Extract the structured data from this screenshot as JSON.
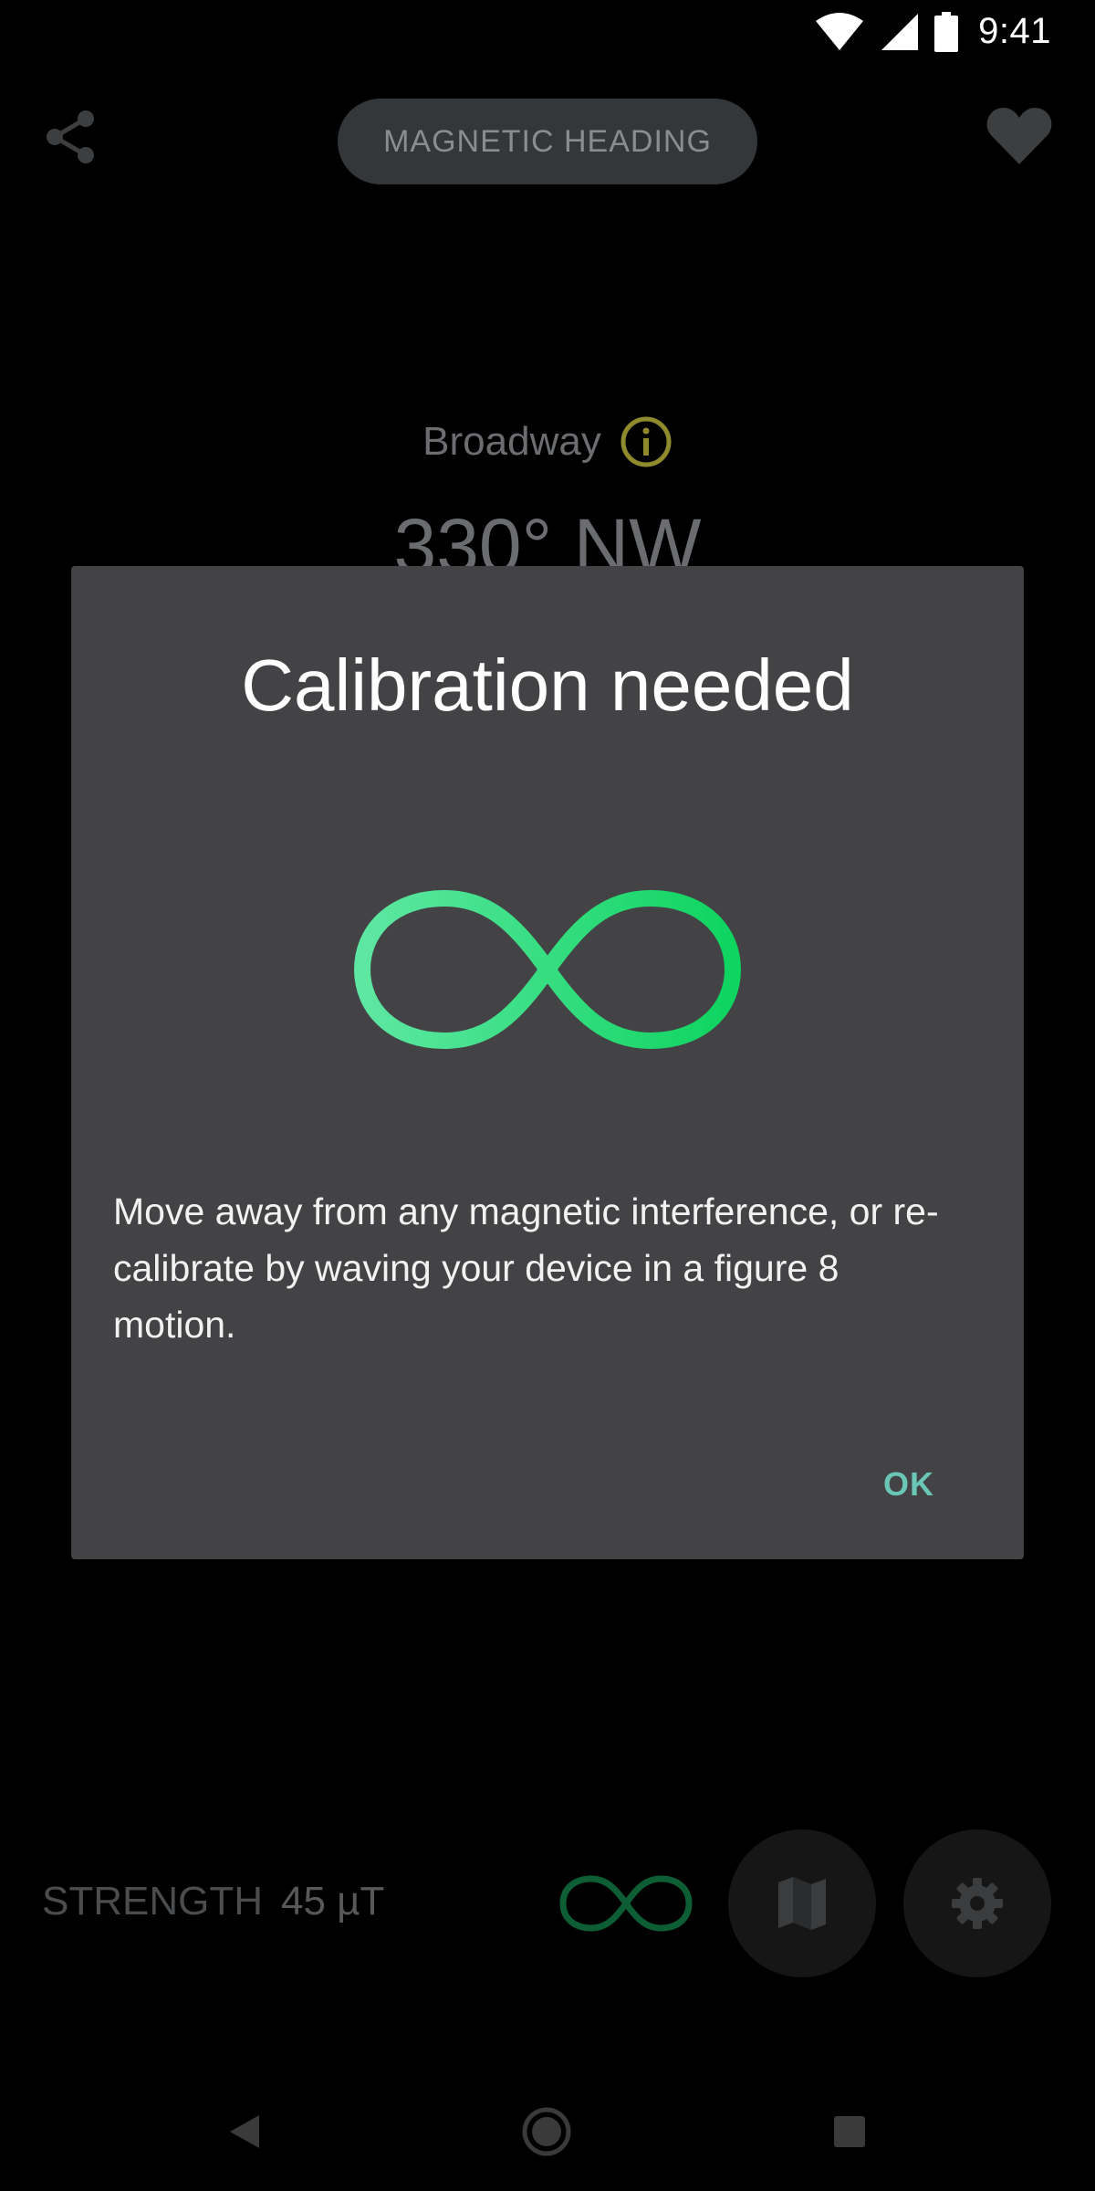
{
  "status_bar": {
    "time": "9:41"
  },
  "header": {
    "mode_label": "MAGNETIC HEADING"
  },
  "compass": {
    "location": "Broadway",
    "heading": "330° NW"
  },
  "dialog": {
    "title": "Calibration needed",
    "message": "Move away from any magnetic interference, or re-calibrate by waving your device in a figure 8 motion.",
    "ok_label": "OK"
  },
  "bottom": {
    "strength_label": "STRENGTH",
    "strength_value": "45 µT"
  },
  "colors": {
    "accent_green": "#1fd66b",
    "ok_teal": "#6ac6b6",
    "dialog_bg": "#434345",
    "info_yellow": "#8f8a2e"
  },
  "icons": [
    "wifi-icon",
    "cellular-icon",
    "battery-icon",
    "share-icon",
    "heart-icon",
    "info-icon",
    "infinity-icon",
    "map-icon",
    "gear-icon",
    "back-icon",
    "home-icon",
    "recent-apps-icon"
  ]
}
